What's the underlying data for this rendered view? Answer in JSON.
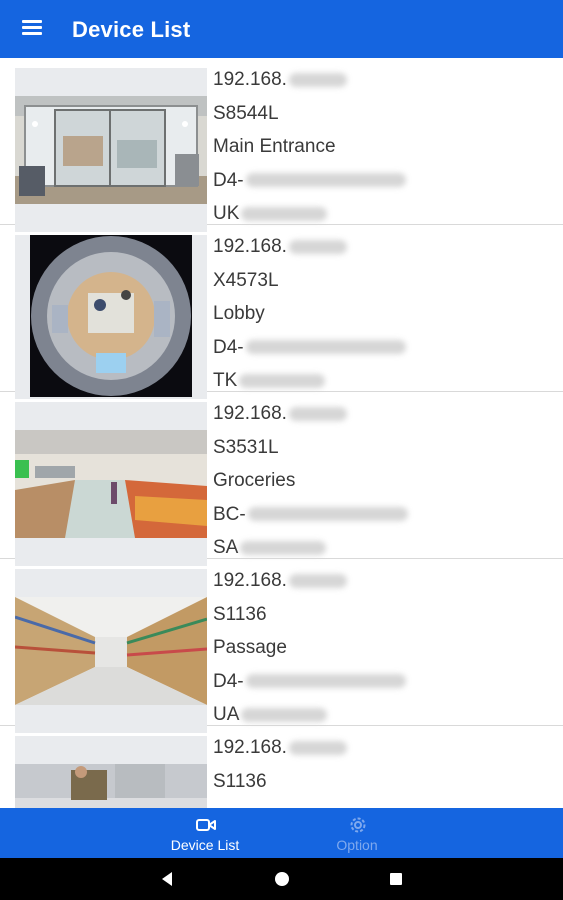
{
  "header": {
    "title": "Device List",
    "menu_icon": "menu-icon"
  },
  "devices": [
    {
      "ip": "192.168.",
      "model": "S8544L",
      "name": "Main Entrance",
      "mac_prefix": "D4-",
      "serial_prefix": "UK",
      "thumbnail": "store-entrance-camera-image"
    },
    {
      "ip": "192.168.",
      "model": "X4573L",
      "name": "Lobby",
      "mac_prefix": "D4-",
      "serial_prefix": "TK",
      "thumbnail": "fisheye-lobby-camera-image"
    },
    {
      "ip": "192.168.",
      "model": "S3531L",
      "name": "Groceries",
      "mac_prefix": "BC-",
      "serial_prefix": "SA",
      "thumbnail": "grocery-aisle-camera-image"
    },
    {
      "ip": "192.168.",
      "model": "S1136",
      "name": "Passage",
      "mac_prefix": "D4-",
      "serial_prefix": "UA",
      "thumbnail": "supermarket-passage-camera-image"
    },
    {
      "ip": "192.168.",
      "model": "S1136",
      "thumbnail": "checkout-camera-image"
    }
  ],
  "bottom_nav": [
    {
      "label": "Device List",
      "icon": "video-camera-icon",
      "active": true
    },
    {
      "label": "Option",
      "icon": "gear-icon",
      "active": false
    }
  ],
  "system_nav": {
    "back": "back-icon",
    "home": "home-icon",
    "recents": "recents-icon"
  },
  "colors": {
    "primary": "#1565e0",
    "inactive_nav": "#7fa9ee",
    "text": "#3a3a3a"
  }
}
